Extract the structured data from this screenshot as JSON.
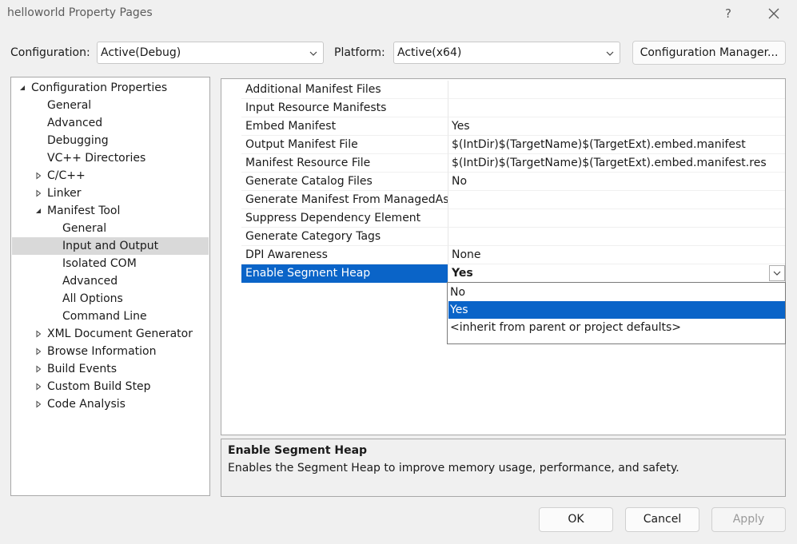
{
  "window": {
    "title": "helloworld Property Pages",
    "help": "?"
  },
  "config": {
    "configuration_label": "Configuration:",
    "configuration_value": "Active(Debug)",
    "platform_label": "Platform:",
    "platform_value": "Active(x64)",
    "manager_button": "Configuration Manager..."
  },
  "tree": {
    "items": [
      {
        "label": "Configuration Properties",
        "expander": "expanded"
      },
      {
        "label": "General",
        "expander": "none"
      },
      {
        "label": "Advanced",
        "expander": "none"
      },
      {
        "label": "Debugging",
        "expander": "none"
      },
      {
        "label": "VC++ Directories",
        "expander": "none"
      },
      {
        "label": "C/C++",
        "expander": "collapsed"
      },
      {
        "label": "Linker",
        "expander": "collapsed"
      },
      {
        "label": "Manifest Tool",
        "expander": "expanded"
      },
      {
        "label": "General",
        "expander": "none"
      },
      {
        "label": "Input and Output",
        "expander": "none",
        "selected": true
      },
      {
        "label": "Isolated COM",
        "expander": "none"
      },
      {
        "label": "Advanced",
        "expander": "none"
      },
      {
        "label": "All Options",
        "expander": "none"
      },
      {
        "label": "Command Line",
        "expander": "none"
      },
      {
        "label": "XML Document Generator",
        "expander": "collapsed"
      },
      {
        "label": "Browse Information",
        "expander": "collapsed"
      },
      {
        "label": "Build Events",
        "expander": "collapsed"
      },
      {
        "label": "Custom Build Step",
        "expander": "collapsed"
      },
      {
        "label": "Code Analysis",
        "expander": "collapsed"
      }
    ]
  },
  "grid": {
    "rows": [
      {
        "name": "Additional Manifest Files",
        "value": ""
      },
      {
        "name": "Input Resource Manifests",
        "value": ""
      },
      {
        "name": "Embed Manifest",
        "value": "Yes"
      },
      {
        "name": "Output Manifest File",
        "value": "$(IntDir)$(TargetName)$(TargetExt).embed.manifest"
      },
      {
        "name": "Manifest Resource File",
        "value": "$(IntDir)$(TargetName)$(TargetExt).embed.manifest.res"
      },
      {
        "name": "Generate Catalog Files",
        "value": "No"
      },
      {
        "name": "Generate Manifest From ManagedAsse",
        "value": ""
      },
      {
        "name": "Suppress Dependency Element",
        "value": ""
      },
      {
        "name": "Generate Category Tags",
        "value": ""
      },
      {
        "name": "DPI Awareness",
        "value": "None"
      },
      {
        "name": "Enable Segment Heap",
        "value": "Yes",
        "selected": true
      }
    ]
  },
  "dropdown": {
    "options": [
      "No",
      "Yes",
      "<inherit from parent or project defaults>"
    ],
    "selected": "Yes"
  },
  "description": {
    "title": "Enable Segment Heap",
    "text": "Enables the Segment Heap to improve memory usage, performance, and safety."
  },
  "buttons": {
    "ok": "OK",
    "cancel": "Cancel",
    "apply": "Apply"
  },
  "colors": {
    "selection": "#0a64c8",
    "tree_selection": "#d9d9d9",
    "disabled_text": "#9a9a9a"
  }
}
